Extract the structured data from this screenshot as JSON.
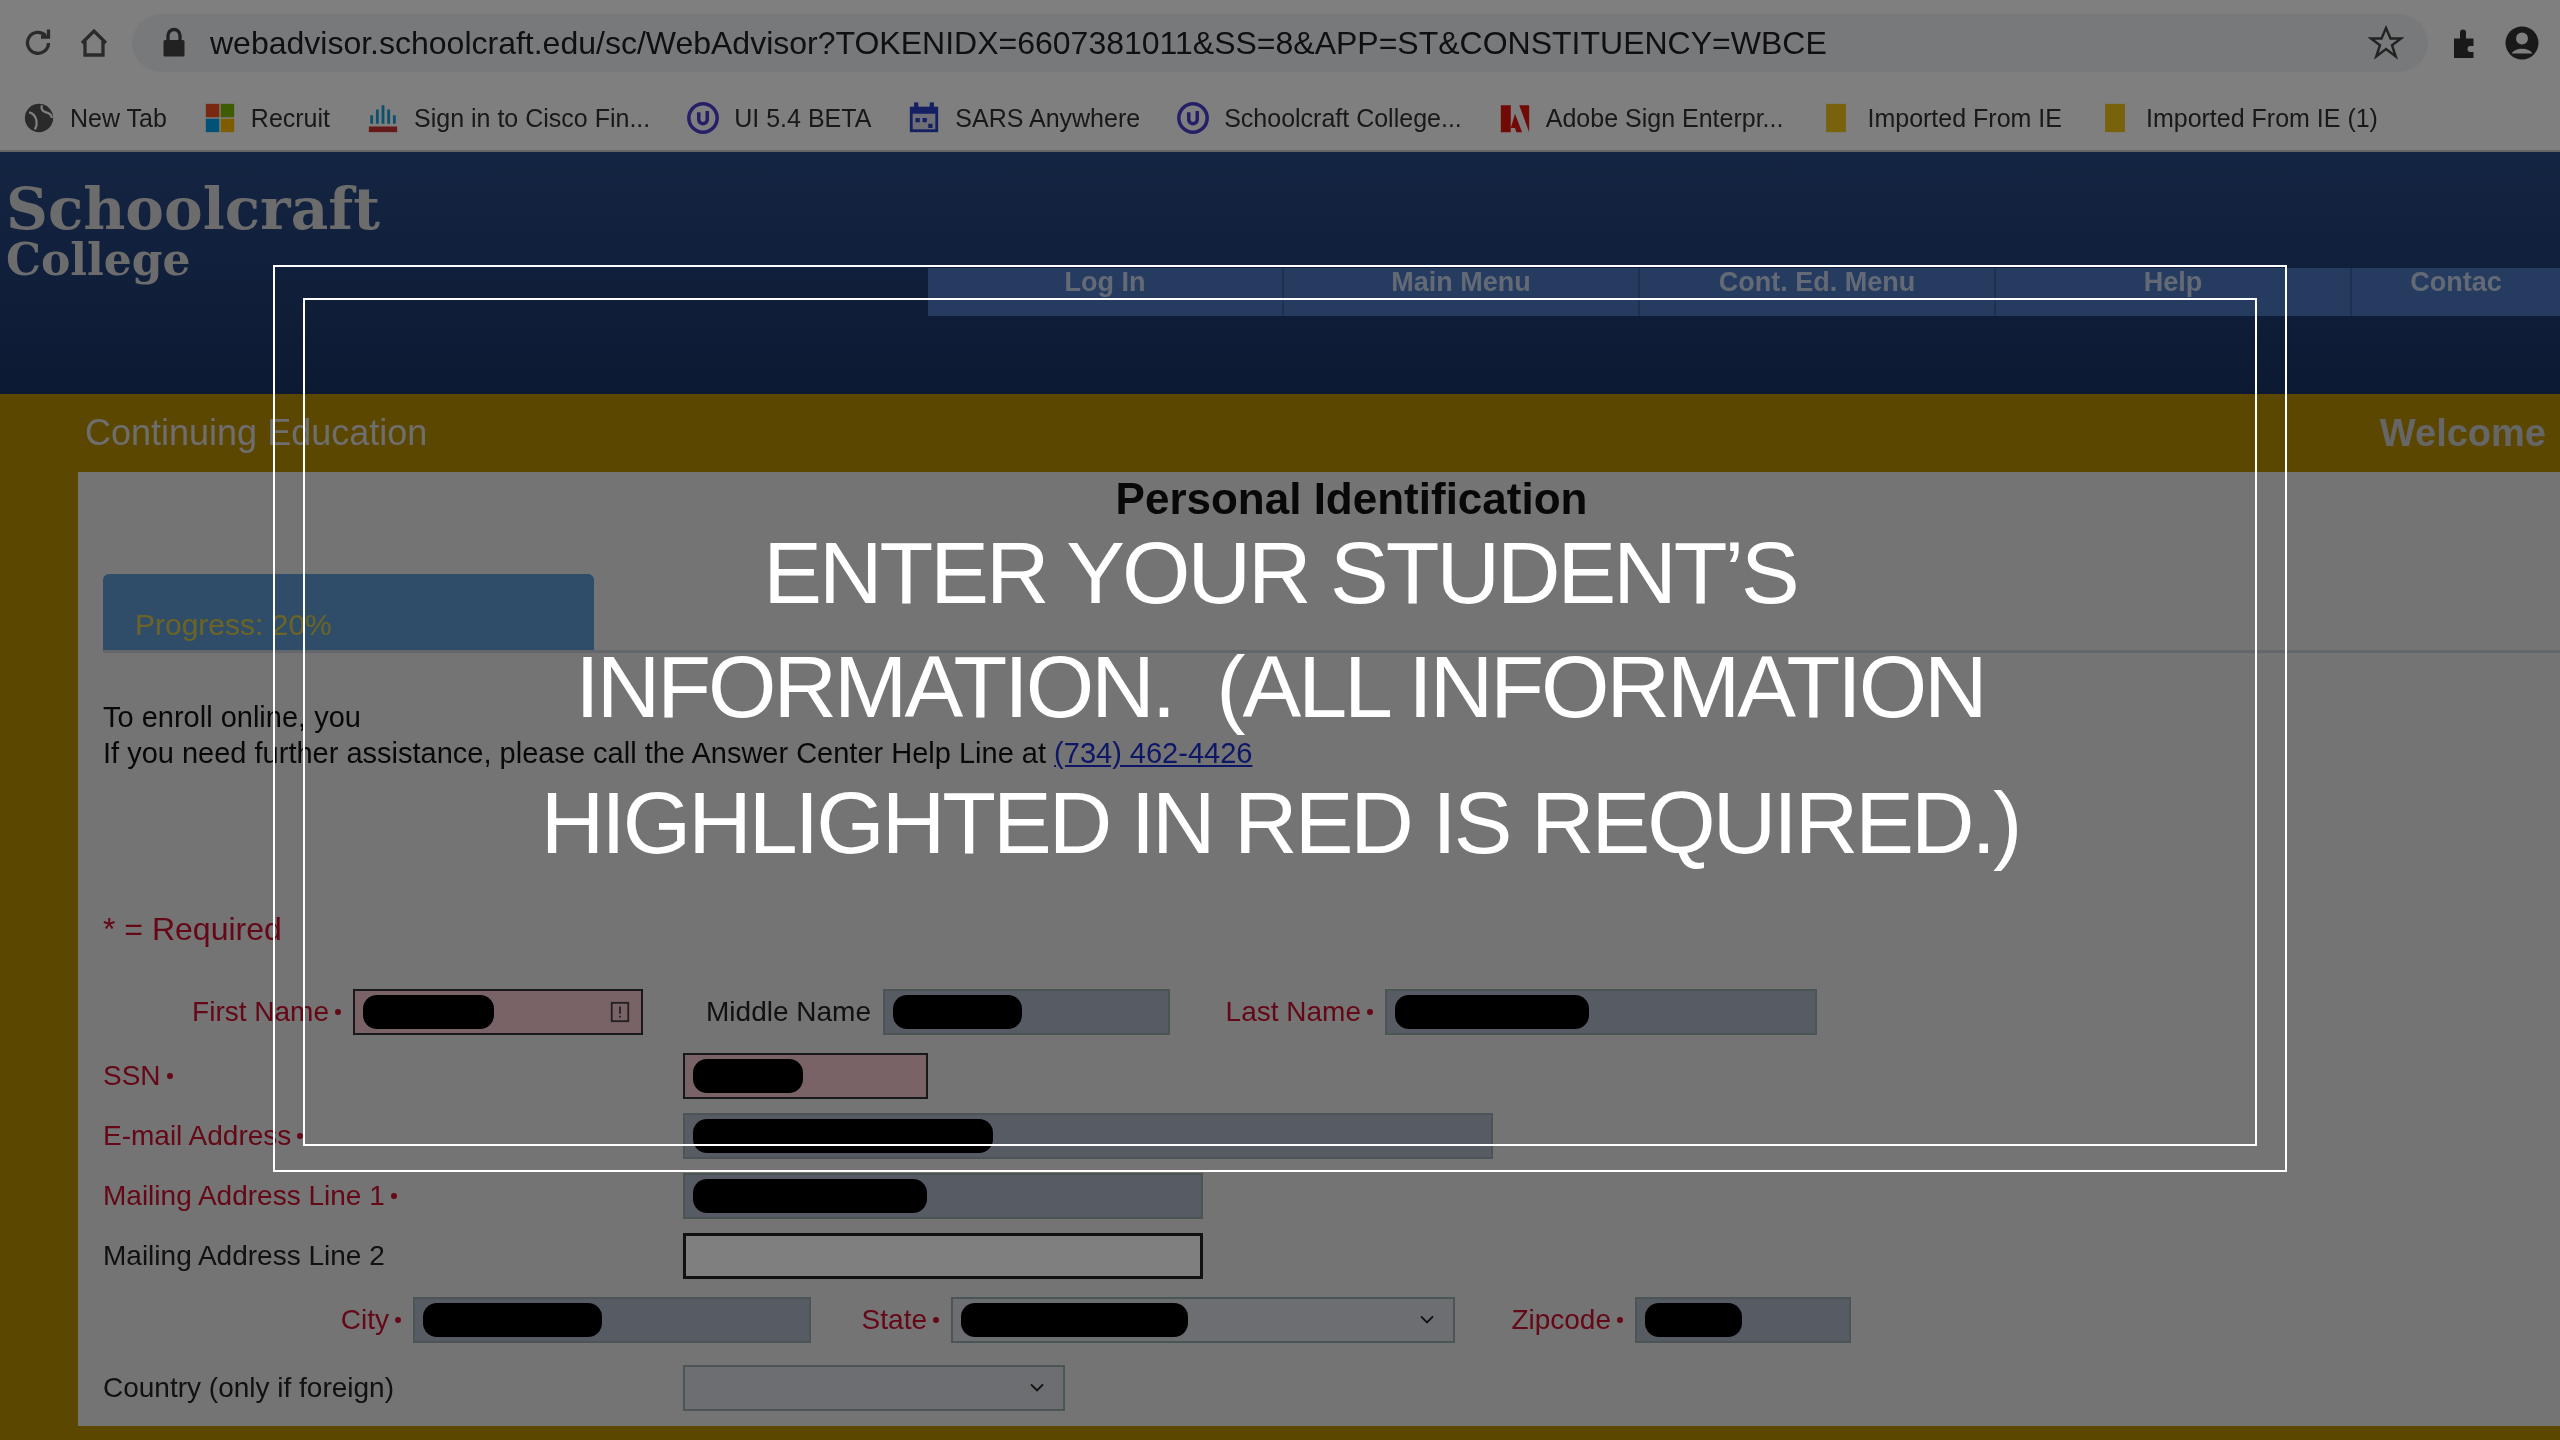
{
  "browser": {
    "url": "webadvisor.schoolcraft.edu/sc/WebAdvisor?TOKENIDX=6607381011&SS=8&APP=ST&CONSTITUENCY=WBCE",
    "bookmarks": [
      {
        "label": "New Tab",
        "kind": "globe"
      },
      {
        "label": "Recruit",
        "kind": "squares"
      },
      {
        "label": "Sign in to Cisco Fin...",
        "kind": "bars"
      },
      {
        "label": "UI 5.4 BETA",
        "kind": "ring"
      },
      {
        "label": "SARS Anywhere",
        "kind": "calendar"
      },
      {
        "label": "Schoolcraft College...",
        "kind": "ring"
      },
      {
        "label": "Adobe Sign Enterpr...",
        "kind": "adobe"
      },
      {
        "label": "Imported From IE",
        "kind": "folder"
      },
      {
        "label": "Imported From IE (1)",
        "kind": "folder"
      }
    ]
  },
  "header": {
    "logo_line_1": "Schoolcraft",
    "logo_line_2": "College",
    "nav": [
      "Log In",
      "Main Menu",
      "Cont. Ed. Menu",
      "Help",
      "Contac"
    ]
  },
  "banner": {
    "section": "Continuing Education",
    "welcome": "Welcome"
  },
  "page": {
    "heading": "Personal Identification",
    "progress": {
      "label": "Progress: 20%",
      "level": 0.2
    },
    "intro": [
      "To enroll online, you",
      "If you need further assistance, please call the Answer Center Help Line at "
    ],
    "phone_link": "(734) 462-4426",
    "required_note": "* = Required"
  },
  "form": {
    "rows": [
      {
        "fields": [
          {
            "label": "First Name",
            "required": true,
            "kind": "text",
            "invalid": true,
            "redacted": true,
            "focused": false
          },
          {
            "label": "Middle Name",
            "required": false,
            "kind": "text",
            "invalid": false,
            "redacted": true,
            "focused": false
          },
          {
            "label": "Last Name",
            "required": true,
            "kind": "text",
            "invalid": false,
            "redacted": true,
            "focused": false
          }
        ]
      },
      {
        "fields": [
          {
            "label": "SSN",
            "required": true,
            "kind": "text",
            "invalid": true,
            "redacted": true,
            "focused": false
          }
        ]
      },
      {
        "fields": [
          {
            "label": "E-mail Address",
            "required": true,
            "kind": "text",
            "invalid": false,
            "redacted": true,
            "focused": false
          }
        ]
      },
      {
        "fields": [
          {
            "label": "Mailing Address Line 1",
            "required": true,
            "kind": "text",
            "invalid": false,
            "redacted": true,
            "focused": false
          }
        ]
      },
      {
        "fields": [
          {
            "label": "Mailing Address Line 2",
            "required": false,
            "kind": "text",
            "invalid": false,
            "redacted": false,
            "focused": true
          }
        ]
      },
      {
        "fields": [
          {
            "label": "City",
            "required": true,
            "kind": "text",
            "invalid": false,
            "redacted": true,
            "focused": false
          },
          {
            "label": "State",
            "required": true,
            "kind": "select",
            "invalid": false,
            "redacted": true,
            "focused": false
          },
          {
            "label": "Zipcode",
            "required": true,
            "kind": "text",
            "invalid": false,
            "redacted": true,
            "focused": false
          }
        ]
      },
      {
        "fields": [
          {
            "label": "Country (only if foreign)",
            "required": false,
            "kind": "select",
            "invalid": false,
            "redacted": false,
            "focused": false
          }
        ]
      }
    ]
  },
  "overlay": {
    "caption_lines": [
      "ENTER YOUR STUDENT’S",
      "INFORMATION.  (ALL INFORMATION",
      "HIGHLIGHTED IN RED IS REQUIRED.)"
    ]
  }
}
